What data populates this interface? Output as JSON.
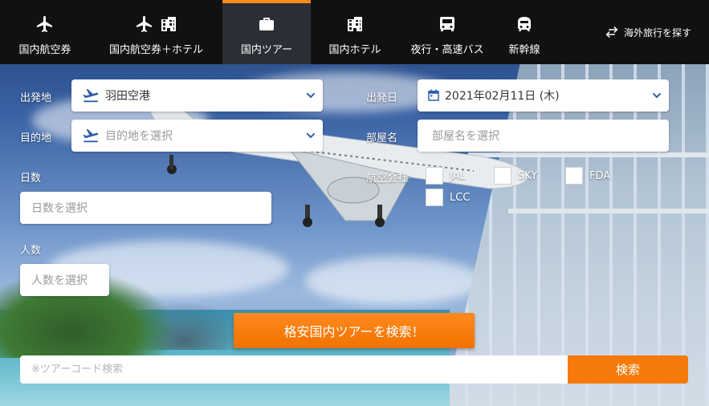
{
  "nav": {
    "tabs": [
      {
        "label": "国内航空券",
        "icons": [
          "airplane-icon"
        ]
      },
      {
        "label": "国内航空券＋ホテル",
        "icons": [
          "airplane-icon",
          "hotel-icon"
        ]
      },
      {
        "label": "国内ツアー",
        "icons": [
          "suitcase-icon"
        ],
        "active": true
      },
      {
        "label": "国内ホテル",
        "icons": [
          "hotel-icon"
        ]
      },
      {
        "label": "夜行・高速バス",
        "icons": [
          "bus-icon"
        ]
      },
      {
        "label": "新幹線",
        "icons": [
          "train-icon"
        ]
      }
    ],
    "overseas_label": "海外旅行を探す"
  },
  "form": {
    "departure": {
      "label": "出発地",
      "value": "羽田空港"
    },
    "destination": {
      "label": "目的地",
      "placeholder": "目的地を選択"
    },
    "days": {
      "label": "日数",
      "placeholder": "日数を選択"
    },
    "people": {
      "label": "人数",
      "placeholder": "人数を選択"
    },
    "date": {
      "label": "出発日",
      "value": "2021年02月11日 (木)"
    },
    "room": {
      "label": "部屋名",
      "placeholder": "部屋名を選択"
    },
    "airline": {
      "label": "航空会社",
      "options": [
        "JAL",
        "SKY",
        "FDA",
        "LCC"
      ]
    }
  },
  "search_button": "格安国内ツアーを検索！",
  "tour_code": {
    "placeholder": "※ツアーコード検索",
    "button": "検索"
  },
  "colors": {
    "accent": "#f57a0a",
    "nav_bg": "#111111",
    "icon_blue": "#2e5ea8"
  }
}
